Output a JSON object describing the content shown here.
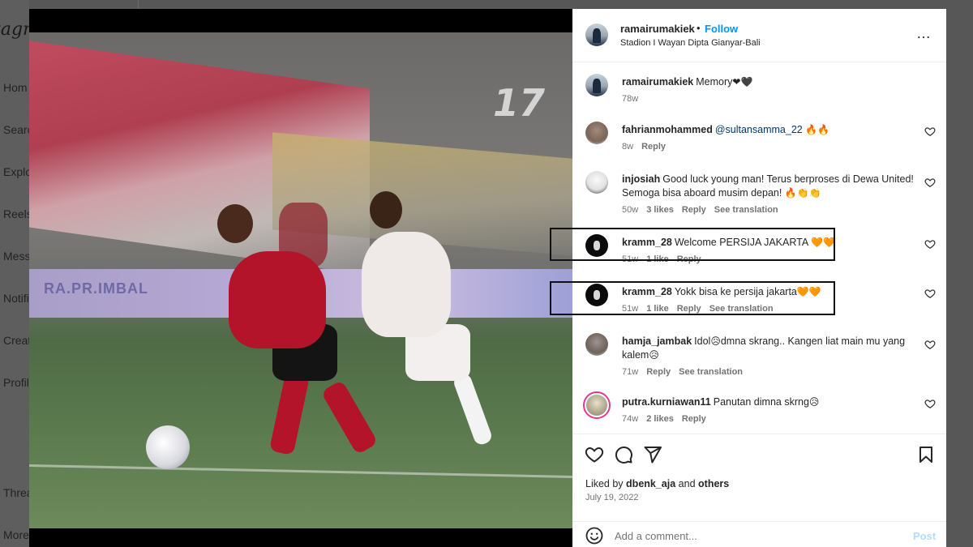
{
  "background": {
    "logo_fragment": "tagr",
    "nav": [
      "Hom",
      "Searc",
      "Explo",
      "Reels",
      "Mess",
      "Notifi",
      "Creat",
      "Profil",
      "Threa",
      "More"
    ]
  },
  "post": {
    "username": "ramairumakiek",
    "separator": "•",
    "follow_label": "Follow",
    "location": "Stadion I Wayan Dipta Gianyar-Bali",
    "more_icon": "…",
    "photo_ad_text": "RA.PR.IMBAL"
  },
  "comments": [
    {
      "user": "ramairumakiek",
      "text": "Memory",
      "emoji": "❤🖤",
      "time": "78w",
      "likes": "",
      "reply": "",
      "translation": ""
    },
    {
      "user": "fahrianmohammed",
      "mention": "@sultansamma_22",
      "text": "",
      "emoji": "🔥🔥",
      "time": "8w",
      "likes": "",
      "reply": "Reply",
      "translation": ""
    },
    {
      "user": "injosiah",
      "text": "Good luck young man! Terus berproses di Dewa United! Semoga bisa aboard musim depan!",
      "emoji": "🔥👏👏",
      "time": "50w",
      "likes": "3 likes",
      "reply": "Reply",
      "translation": "See translation"
    },
    {
      "user": "kramm_28",
      "text": "Welcome PERSIJA JAKARTA",
      "emoji": "🧡🧡",
      "time": "51w",
      "likes": "1 like",
      "reply": "Reply",
      "translation": ""
    },
    {
      "user": "kramm_28",
      "text": "Yokk bisa ke persija jakarta",
      "emoji": "🧡🧡",
      "time": "51w",
      "likes": "1 like",
      "reply": "Reply",
      "translation": "See translation"
    },
    {
      "user": "hamja_jambak",
      "text": "Idol",
      "text2": "dmna skrang.. Kangen liat main mu yang kalem",
      "emoji": "😥",
      "time": "71w",
      "likes": "",
      "reply": "Reply",
      "translation": "See translation"
    },
    {
      "user": "putra.kurniawan11",
      "text": "Panutan dimna skrng",
      "emoji": "😥",
      "time": "74w",
      "likes": "2 likes",
      "reply": "Reply",
      "translation": ""
    }
  ],
  "footer": {
    "liked_prefix": "Liked by",
    "liked_user": "dbenk_aja",
    "liked_and": "and",
    "liked_others": "others",
    "date": "July 19, 2022",
    "add_comment_placeholder": "Add a comment...",
    "post_label": "Post"
  },
  "colors": {
    "accent": "#0095f6",
    "highlight_box": "#111111",
    "post_disabled": "#b3dbfb"
  }
}
